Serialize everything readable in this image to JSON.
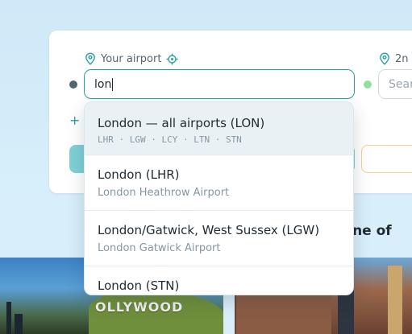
{
  "colors": {
    "accent": "#21a39a",
    "origin_dot": "#536570",
    "destination_dot": "#8fe0a2"
  },
  "origin": {
    "label": "Your airport",
    "label_icon": "map-pin-icon",
    "locate_icon": "crosshair-icon",
    "value": "lon"
  },
  "destination": {
    "label_partial": "2n",
    "label_icon": "map-pin-icon",
    "placeholder_partial": "Sear"
  },
  "add_icon": "plus-icon",
  "section_heading_partial": "ry one of",
  "photo_text": {
    "hollywood_sign": "OLLYWOOD"
  },
  "suggestions": [
    {
      "title": "London — all airports (LON)",
      "codes": "LHR · LGW · LCY · LTN · STN"
    },
    {
      "title": "London (LHR)",
      "subtitle": "London Heathrow Airport"
    },
    {
      "title": "London/Gatwick, West Sussex (LGW)",
      "subtitle": "London Gatwick Airport"
    },
    {
      "title": "London (STN)"
    }
  ]
}
